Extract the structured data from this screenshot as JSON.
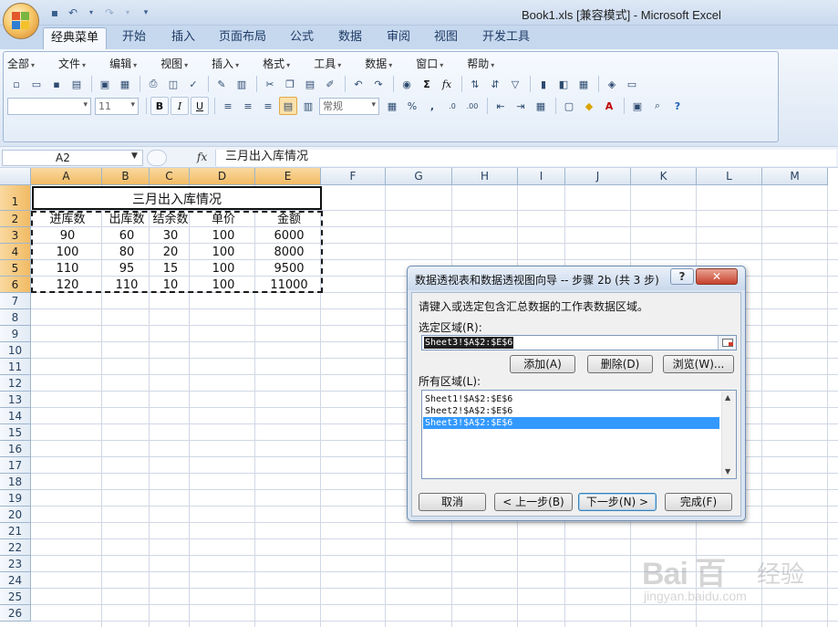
{
  "window": {
    "title": "Book1.xls  [兼容模式] - Microsoft Excel"
  },
  "ribbon": {
    "tabs": [
      {
        "label": "经典菜单",
        "active": true
      },
      {
        "label": "开始"
      },
      {
        "label": "插入"
      },
      {
        "label": "页面布局"
      },
      {
        "label": "公式"
      },
      {
        "label": "数据"
      },
      {
        "label": "审阅"
      },
      {
        "label": "视图"
      },
      {
        "label": "开发工具"
      }
    ],
    "menus": [
      "全部",
      "文件",
      "编辑",
      "视图",
      "插入",
      "格式",
      "工具",
      "数据",
      "窗口",
      "帮助"
    ],
    "font_size": "11",
    "number_format": "常规",
    "bold": "B",
    "italic": "I",
    "underline": "U",
    "percent": "%",
    "comma": ",",
    "sum": "Σ",
    "function": "fx"
  },
  "formula_bar": {
    "name_box": "A2",
    "fx": "fx",
    "formula": "三月出入库情况"
  },
  "sheet": {
    "columns": [
      "A",
      "B",
      "C",
      "D",
      "E",
      "F",
      "G",
      "H",
      "I",
      "J",
      "K",
      "L",
      "M"
    ],
    "selected_columns": [
      "A",
      "B",
      "C",
      "D",
      "E"
    ],
    "rows": [
      "1",
      "2",
      "3",
      "4",
      "5",
      "6",
      "7",
      "8",
      "9",
      "10",
      "11",
      "12",
      "13",
      "14",
      "15",
      "16",
      "17",
      "18",
      "19",
      "20",
      "21",
      "22",
      "23",
      "24",
      "25",
      "26"
    ],
    "selected_rows": [
      "1",
      "2",
      "3",
      "4",
      "5",
      "6"
    ],
    "title_cell": "三月出入库情况",
    "headers": [
      "进库数",
      "出库数",
      "结余数",
      "单价",
      "金额"
    ],
    "data": [
      [
        "90",
        "60",
        "30",
        "100",
        "6000"
      ],
      [
        "100",
        "80",
        "20",
        "100",
        "8000"
      ],
      [
        "110",
        "95",
        "15",
        "100",
        "9500"
      ],
      [
        "120",
        "110",
        "10",
        "100",
        "11000"
      ]
    ]
  },
  "dialog": {
    "title": "数据透视表和数据透视图向导 -- 步骤 2b (共 3 步)",
    "help": "?",
    "close": "✕",
    "instruction": "请键入或选定包含汇总数据的工作表数据区域。",
    "range_label": "选定区域(R):",
    "range_value": "Sheet3!$A$2:$E$6",
    "add_button": "添加(A)",
    "delete_button": "删除(D)",
    "browse_button": "浏览(W)...",
    "all_ranges_label": "所有区域(L):",
    "all_ranges": [
      {
        "text": "Sheet1!$A$2:$E$6",
        "selected": false
      },
      {
        "text": "Sheet2!$A$2:$E$6",
        "selected": false
      },
      {
        "text": "Sheet3!$A$2:$E$6",
        "selected": true
      }
    ],
    "cancel_button": "取消",
    "back_button": "< 上一步(B)",
    "next_button": "下一步(N) >",
    "finish_button": "完成(F)"
  },
  "watermark": {
    "logo": "Bai 百",
    "sub": "经验",
    "url": "jingyan.baidu.com"
  }
}
